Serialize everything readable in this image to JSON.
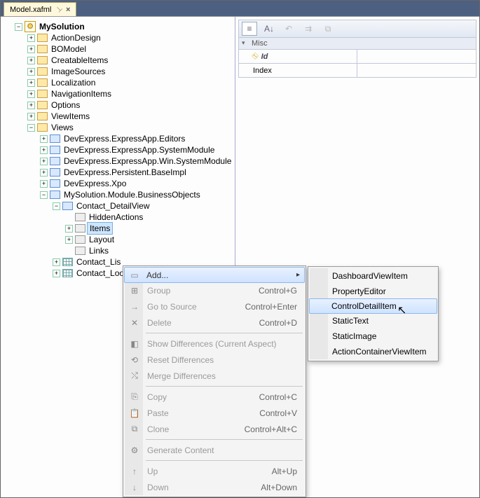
{
  "tab": {
    "title": "Model.xafml"
  },
  "tree": {
    "root": "MySolution",
    "l1": {
      "n0": "ActionDesign",
      "n1": "BOModel",
      "n2": "CreatableItems",
      "n3": "ImageSources",
      "n4": "Localization",
      "n5": "NavigationItems",
      "n6": "Options",
      "n7": "ViewItems",
      "n8": "Views"
    },
    "views": {
      "v0": "DevExpress.ExpressApp.Editors",
      "v1": "DevExpress.ExpressApp.SystemModule",
      "v2": "DevExpress.ExpressApp.Win.SystemModule",
      "v3": "DevExpress.Persistent.BaseImpl",
      "v4": "DevExpress.Xpo",
      "v5": "MySolution.Module.BusinessObjects"
    },
    "bo": {
      "b0": "Contact_DetailView",
      "b1": "Contact_Lis",
      "b2": "Contact_Loo"
    },
    "dv": {
      "d0": "HiddenActions",
      "d1": "Items",
      "d2": "Layout",
      "d3": "Links"
    }
  },
  "props": {
    "category": "Misc",
    "rows": {
      "r0": "Id",
      "r1": "Index"
    }
  },
  "ctx": {
    "add": {
      "label": "Add..."
    },
    "group": {
      "label": "Group",
      "shortcut": "Control+G"
    },
    "goto": {
      "label": "Go to Source",
      "shortcut": "Control+Enter"
    },
    "delete": {
      "label": "Delete",
      "shortcut": "Control+D"
    },
    "showdiff": {
      "label": "Show Differences (Current Aspect)"
    },
    "resetdiff": {
      "label": "Reset Differences"
    },
    "mergediff": {
      "label": "Merge Differences"
    },
    "copy": {
      "label": "Copy",
      "shortcut": "Control+C"
    },
    "paste": {
      "label": "Paste",
      "shortcut": "Control+V"
    },
    "clone": {
      "label": "Clone",
      "shortcut": "Control+Alt+C"
    },
    "generate": {
      "label": "Generate Content"
    },
    "up": {
      "label": "Up",
      "shortcut": "Alt+Up"
    },
    "down": {
      "label": "Down",
      "shortcut": "Alt+Down"
    }
  },
  "sub": {
    "s0": "DashboardViewItem",
    "s1": "PropertyEditor",
    "s2": "ControlDetailItem",
    "s3": "StaticText",
    "s4": "StaticImage",
    "s5": "ActionContainerViewItem"
  }
}
